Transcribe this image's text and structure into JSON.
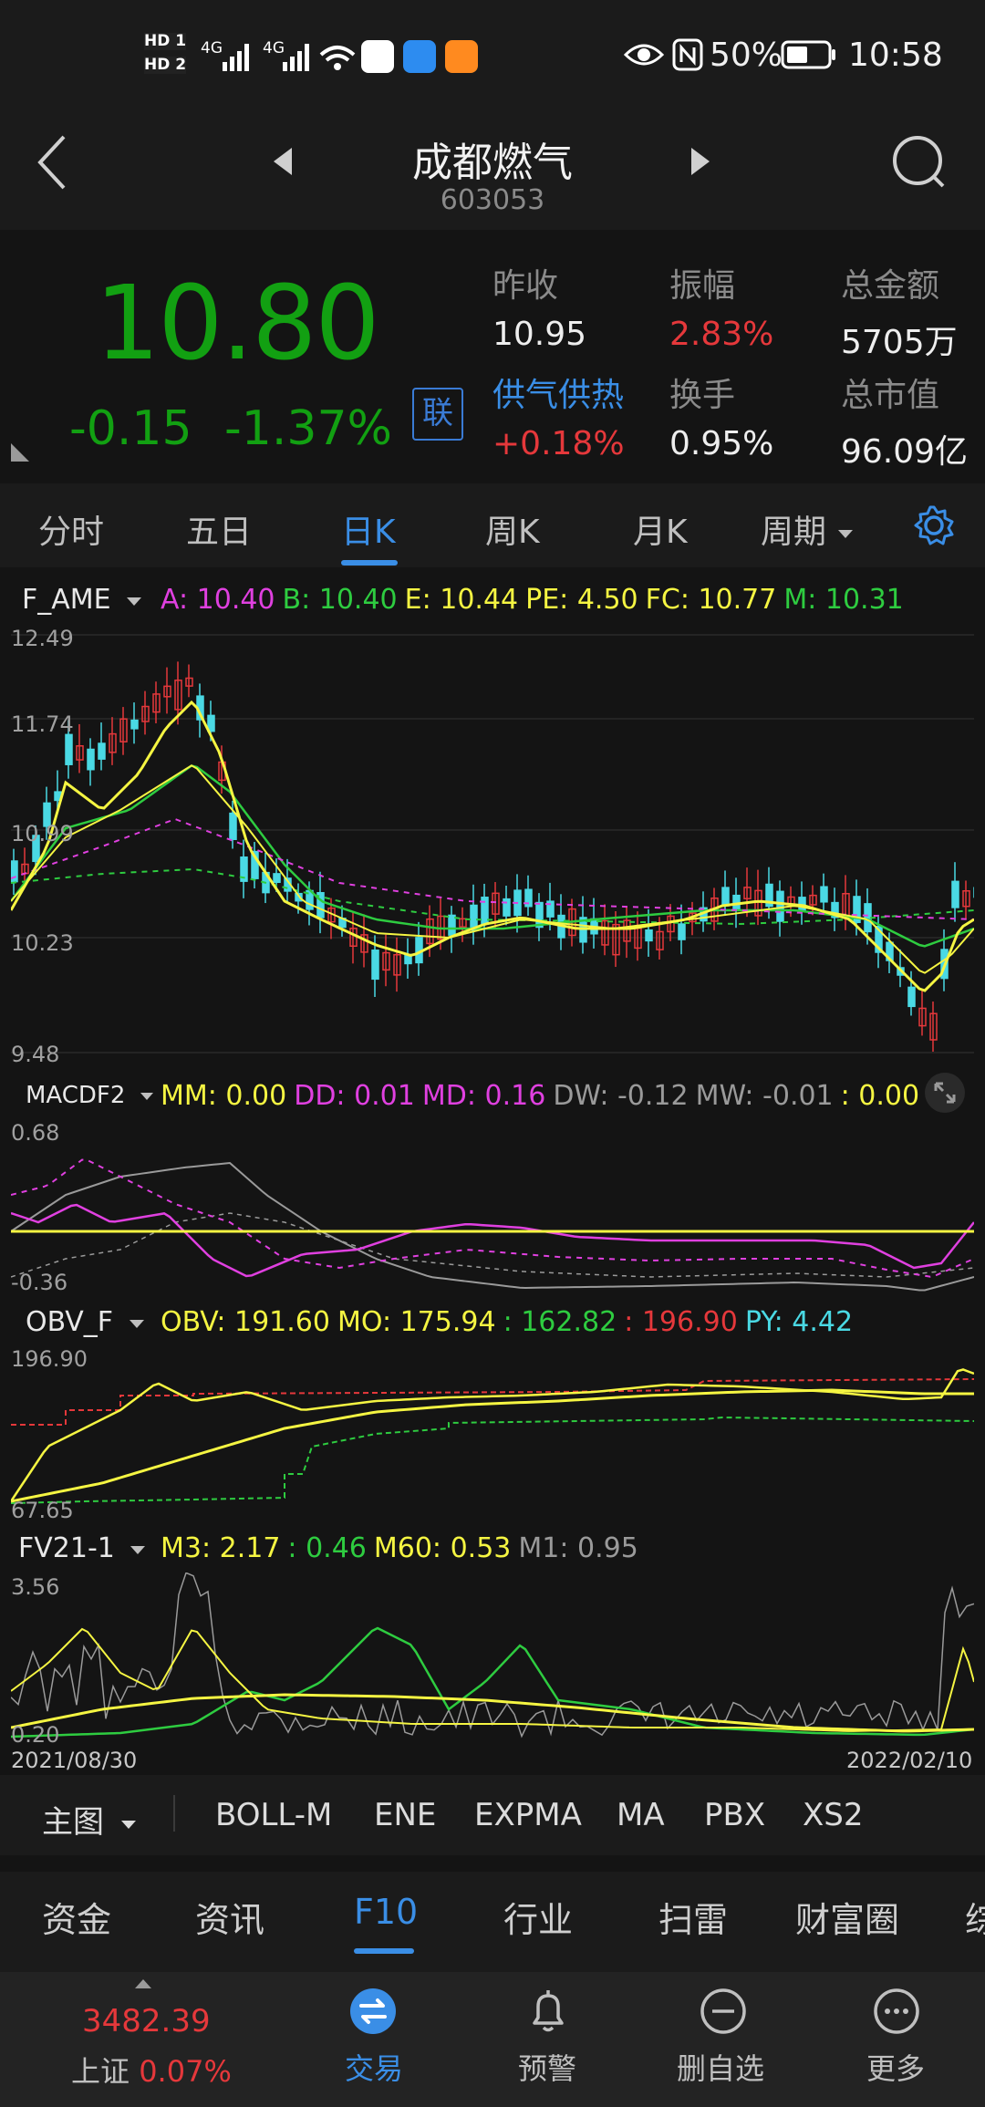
{
  "status_bar": {
    "badge1": "HD 1",
    "badge2": "HD 2",
    "net1": "4G",
    "net2": "4G",
    "battery": "50%",
    "time": "10:58"
  },
  "header": {
    "title": "成都燃气",
    "code": "603053"
  },
  "quote": {
    "price": "10.80",
    "change": "-0.15",
    "change_pct": "-1.37%",
    "lian_label": "联",
    "prev_close_label": "昨收",
    "prev_close": "10.95",
    "amplitude_label": "振幅",
    "amplitude": "2.83%",
    "turnover_amt_label": "总金额",
    "turnover_amt": "5705万",
    "sector_label": "供气供热",
    "sector_change": "+0.18%",
    "turnover_rate_label": "换手",
    "turnover_rate": "0.95%",
    "market_cap_label": "总市值",
    "market_cap": "96.09亿"
  },
  "colors": {
    "up": "#e5383b",
    "down": "#12a012",
    "accent": "#3a8ee6",
    "yellow": "#f5f542",
    "magenta": "#e040e0",
    "green_line": "#2ecc40",
    "cyan": "#4ad9e4"
  },
  "chart_tabs": [
    {
      "label": "分时",
      "active": false
    },
    {
      "label": "五日",
      "active": false
    },
    {
      "label": "日K",
      "active": true
    },
    {
      "label": "周K",
      "active": false
    },
    {
      "label": "月K",
      "active": false
    },
    {
      "label": "周期",
      "active": false
    }
  ],
  "main_chart": {
    "indicator": "F_AME",
    "legend": [
      {
        "label": "A: ",
        "value": "10.40",
        "color": "#e040e0"
      },
      {
        "label": "B: ",
        "value": "10.40",
        "color": "#2ecc40"
      },
      {
        "label": "E: ",
        "value": "10.44",
        "color": "#f5f542"
      },
      {
        "label": "PE: ",
        "value": "4.50",
        "color": "#f5f542"
      },
      {
        "label": "FC: ",
        "value": "10.77",
        "color": "#f5f542"
      },
      {
        "label": "M: ",
        "value": "10.31",
        "color": "#2ecc40"
      }
    ],
    "y_labels": [
      "12.49",
      "11.74",
      "10.99",
      "10.23",
      "9.48"
    ]
  },
  "macd_chart": {
    "indicator": "MACDF2",
    "legend": [
      {
        "label": "MM: ",
        "value": "0.00",
        "color": "#f5f542"
      },
      {
        "label": "DD: ",
        "value": "0.01",
        "color": "#e040e0"
      },
      {
        "label": "MD: ",
        "value": "0.16",
        "color": "#e040e0"
      },
      {
        "label": "DW: ",
        "value": "-0.12",
        "color": "#9a9a9a"
      },
      {
        "label": "MW: ",
        "value": "-0.01",
        "color": "#9a9a9a"
      },
      {
        "label": ": ",
        "value": "0.00",
        "color": "#f5f542"
      }
    ],
    "y_top": "0.68",
    "y_bottom": "-0.36"
  },
  "obv_chart": {
    "indicator": "OBV_F",
    "legend": [
      {
        "label": "OBV: ",
        "value": "191.60",
        "color": "#f5f542"
      },
      {
        "label": "MO: ",
        "value": "175.94",
        "color": "#f5f542"
      },
      {
        "label": ": ",
        "value": "162.82",
        "color": "#2ecc40"
      },
      {
        "label": ": ",
        "value": "196.90",
        "color": "#e5383b"
      },
      {
        "label": "PY: ",
        "value": "4.42",
        "color": "#4ad9e4"
      }
    ],
    "y_top": "196.90",
    "y_bottom": "67.65"
  },
  "fv_chart": {
    "indicator": "FV21-1",
    "legend": [
      {
        "label": "M3: ",
        "value": "2.17",
        "color": "#f5f542"
      },
      {
        "label": ": ",
        "value": "0.46",
        "color": "#2ecc40"
      },
      {
        "label": "M60: ",
        "value": "0.53",
        "color": "#f5f542"
      },
      {
        "label": "M1: ",
        "value": "0.95",
        "color": "#9a9a9a"
      }
    ],
    "y_top": "3.56",
    "y_bottom": "0.20",
    "date_start": "2021/08/30",
    "date_end": "2022/02/10"
  },
  "indicator_strip": {
    "main_label": "主图",
    "items": [
      "BOLL-M",
      "ENE",
      "EXPMA",
      "MA",
      "PBX",
      "XS2"
    ]
  },
  "f10_tabs": [
    {
      "label": "资金",
      "active": false
    },
    {
      "label": "资讯",
      "active": false
    },
    {
      "label": "F10",
      "active": true
    },
    {
      "label": "行业",
      "active": false
    },
    {
      "label": "扫雷",
      "active": false
    },
    {
      "label": "财富圈",
      "active": false
    },
    {
      "label": "综",
      "active": false
    }
  ],
  "bottom_nav": {
    "index_value": "3482.39",
    "index_name": "上证",
    "index_change": "0.07%",
    "items": [
      {
        "label": "交易",
        "icon": "trade-icon",
        "active": true
      },
      {
        "label": "预警",
        "icon": "bell-icon",
        "active": false
      },
      {
        "label": "删自选",
        "icon": "minus-circle-icon",
        "active": false
      },
      {
        "label": "更多",
        "icon": "more-icon",
        "active": false
      }
    ]
  }
}
